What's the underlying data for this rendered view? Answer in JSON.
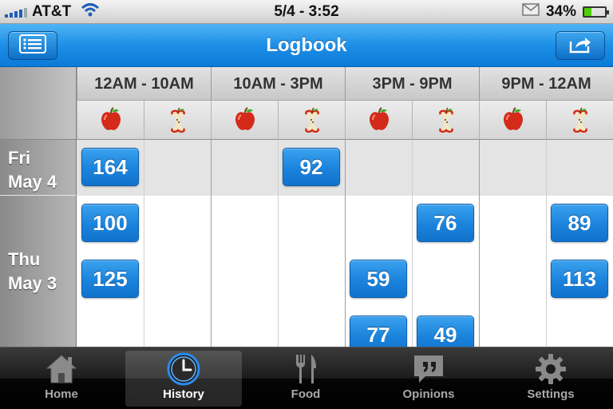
{
  "status_bar": {
    "carrier": "AT&T",
    "time": "5/4 - 3:52",
    "battery_percent": "34%",
    "battery_level": 0.34
  },
  "nav": {
    "title": "Logbook",
    "left_button_icon": "list-icon",
    "right_button_icon": "share-icon"
  },
  "logbook": {
    "periods": [
      "12AM - 10AM",
      "10AM - 3PM",
      "3PM - 9PM",
      "9PM - 12AM"
    ],
    "subcolumn_icons": [
      "apple-icon",
      "apple-core-icon"
    ],
    "days": [
      {
        "label_line1": "Fri",
        "label_line2": "May 4"
      },
      {
        "label_line1": "Thu",
        "label_line2": "May 3"
      }
    ],
    "readings": [
      {
        "day": 0,
        "column": 0,
        "slot": 0,
        "value": "164"
      },
      {
        "day": 0,
        "column": 3,
        "slot": 0,
        "value": "92"
      },
      {
        "day": 1,
        "column": 0,
        "slot": 0,
        "value": "100"
      },
      {
        "day": 1,
        "column": 5,
        "slot": 0,
        "value": "76"
      },
      {
        "day": 1,
        "column": 7,
        "slot": 0,
        "value": "89"
      },
      {
        "day": 1,
        "column": 0,
        "slot": 1,
        "value": "125"
      },
      {
        "day": 1,
        "column": 4,
        "slot": 1,
        "value": "59"
      },
      {
        "day": 1,
        "column": 7,
        "slot": 1,
        "value": "113"
      },
      {
        "day": 1,
        "column": 4,
        "slot": 2,
        "value": "77"
      },
      {
        "day": 1,
        "column": 5,
        "slot": 2,
        "value": "49"
      }
    ]
  },
  "tab_bar": {
    "tabs": [
      {
        "label": "Home",
        "icon": "home-icon",
        "active": false
      },
      {
        "label": "History",
        "icon": "clock-icon",
        "active": true
      },
      {
        "label": "Food",
        "icon": "fork-knife-icon",
        "active": false
      },
      {
        "label": "Opinions",
        "icon": "quote-bubble-icon",
        "active": false
      },
      {
        "label": "Settings",
        "icon": "gear-icon",
        "active": false
      }
    ]
  },
  "colors": {
    "nav_blue": "#1d8fe6",
    "reading_blue": "#1b83dc",
    "battery_green": "#4cd000",
    "apple_red": "#d42a1a"
  }
}
